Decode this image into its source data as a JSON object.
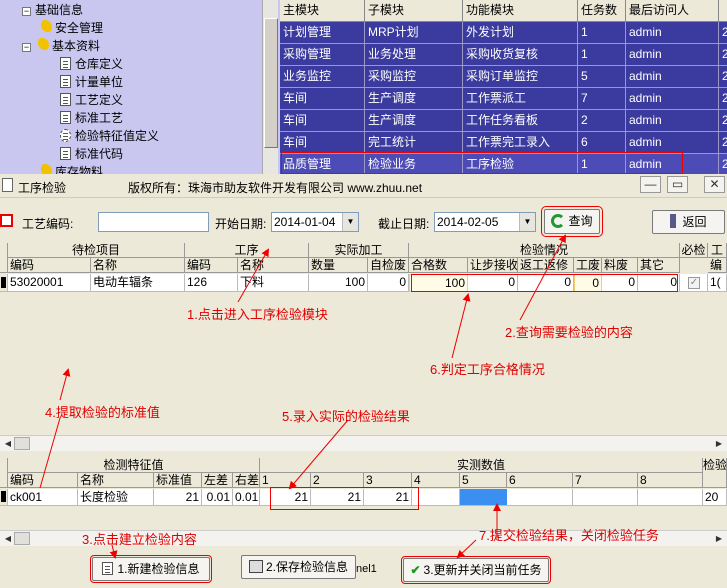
{
  "tree": {
    "items": [
      {
        "label": "基础信息",
        "level": 0
      },
      {
        "label": "安全管理",
        "level": 1
      },
      {
        "label": "基本资料",
        "level": 1
      },
      {
        "label": "仓库定义",
        "level": 2
      },
      {
        "label": "计量单位",
        "level": 2
      },
      {
        "label": "工艺定义",
        "level": 2
      },
      {
        "label": "标准工艺",
        "level": 2
      },
      {
        "label": "检验特征值定义",
        "level": 2
      },
      {
        "label": "标准代码",
        "level": 2
      },
      {
        "label": "库存物料",
        "level": 1
      }
    ]
  },
  "module_grid": {
    "headers": [
      "主模块",
      "子模块",
      "功能模块",
      "任务数",
      "最后访问人",
      ""
    ],
    "rows": [
      [
        "计划管理",
        "MRP计划",
        "外发计划",
        "1",
        "admin",
        "2"
      ],
      [
        "采购管理",
        "业务处理",
        "采购收货复核",
        "1",
        "admin",
        "2"
      ],
      [
        "业务监控",
        "采购监控",
        "采购订单监控",
        "5",
        "admin",
        "2"
      ],
      [
        "车间",
        "生产调度",
        "工作票派工",
        "7",
        "admin",
        "2"
      ],
      [
        "车间",
        "生产调度",
        "工作任务看板",
        "2",
        "admin",
        "2"
      ],
      [
        "车间",
        "完工统计",
        "工作票完工录入",
        "6",
        "admin",
        "2"
      ],
      [
        "品质管理",
        "检验业务",
        "工序检验",
        "1",
        "admin",
        "2"
      ]
    ]
  },
  "window": {
    "title": "工序检验",
    "copyright": "版权所有：珠海市助友软件开发有限公司 www.zhuu.net",
    "min": "—",
    "max": "▭",
    "close": "✕"
  },
  "toolbar": {
    "craft_code_label": "工艺编码:",
    "craft_code_value": "",
    "start_label": "开始日期:",
    "start_value": "2014-01-04",
    "end_label": "截止日期:",
    "end_value": "2014-02-05",
    "query_label": "查询",
    "back_label": "返回"
  },
  "upper_grid": {
    "group_headers": [
      "待检项目",
      "工序",
      "实际加工",
      "检验情况",
      "必检",
      "工"
    ],
    "headers": [
      "编码",
      "名称",
      "编码",
      "名称",
      "数量",
      "自检废",
      "合格数",
      "让步接收",
      "返工返修",
      "工废",
      "料废",
      "其它",
      "",
      "编"
    ],
    "row": [
      "53020001",
      "电动车辐条",
      "126",
      "下料",
      "100",
      "0",
      "100",
      "0",
      "0",
      "0",
      "0",
      "0",
      "",
      "1("
    ]
  },
  "lower_grid": {
    "group_headers": [
      "检测特征值",
      "实测数值",
      "检验"
    ],
    "headers": [
      "编码",
      "名称",
      "标准值",
      "左差",
      "右差",
      "1",
      "2",
      "3",
      "4",
      "5",
      "6",
      "7",
      "8"
    ],
    "row": [
      "ck001",
      "长度检验",
      "21",
      "0.01",
      "0.01",
      "21",
      "21",
      "21",
      "",
      "",
      "",
      "",
      ""
    ],
    "extra": "20"
  },
  "bottom": {
    "new_label": "1.新建检验信息",
    "save_label": "2.保存检验信息",
    "close_label": "3.更新并关闭当前任务",
    "hidden_text": "nel1"
  },
  "annotations": {
    "a1": "1.点击进入工序检验模块",
    "a2": "2.查询需要检验的内容",
    "a3": "3.点击建立检验内容",
    "a4": "4.提取检验的标准值",
    "a5": "5.录入实际的检验结果",
    "a6": "6.判定工序合格情况",
    "a7": "7.提交检验结果，关闭检验任务"
  }
}
